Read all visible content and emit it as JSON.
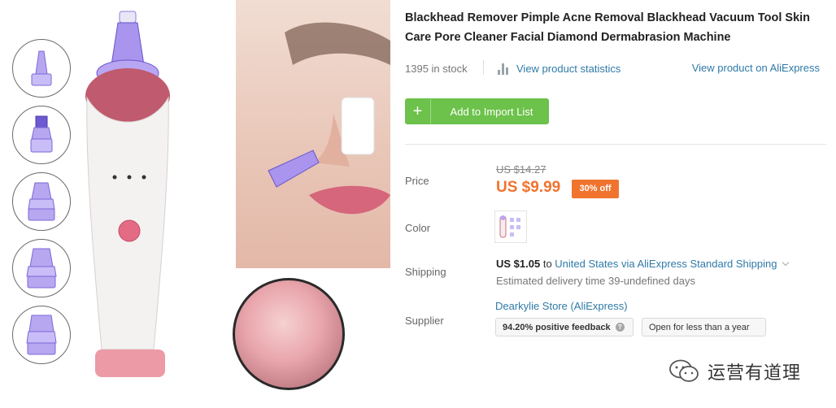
{
  "product": {
    "title": "Blackhead Remover Pimple Acne Removal Blackhead Vacuum Tool Skin Care Pore Cleaner Facial Diamond Dermabrasion Machine",
    "stock": "1395 in stock",
    "stats_link": "View product statistics",
    "aliexpress_link": "View product on AliExpress",
    "add_button": "Add to Import List",
    "add_button_icon": "+"
  },
  "price": {
    "label": "Price",
    "old": "US $14.27",
    "new": "US $9.99",
    "discount": "30% off"
  },
  "color": {
    "label": "Color"
  },
  "shipping": {
    "label": "Shipping",
    "cost": "US $1.05",
    "to": "to",
    "method": "United States via AliExpress Standard Shipping",
    "delivery": "Estimated delivery time 39-undefined days"
  },
  "supplier": {
    "label": "Supplier",
    "name": "Dearkylie Store (AliExpress)",
    "feedback": "94.20% positive feedback",
    "feedback_info_icon": "?",
    "open_for": "Open for less than a year"
  },
  "watermark": {
    "text": "运营有道理"
  },
  "colors": {
    "accent_green": "#6cc24a",
    "price_orange": "#f0732e",
    "link_blue": "#2f7aa8"
  },
  "icons": [
    "bar-chart-icon",
    "plus-icon",
    "chevron-down-icon",
    "info-icon",
    "wechat-logo-icon"
  ]
}
